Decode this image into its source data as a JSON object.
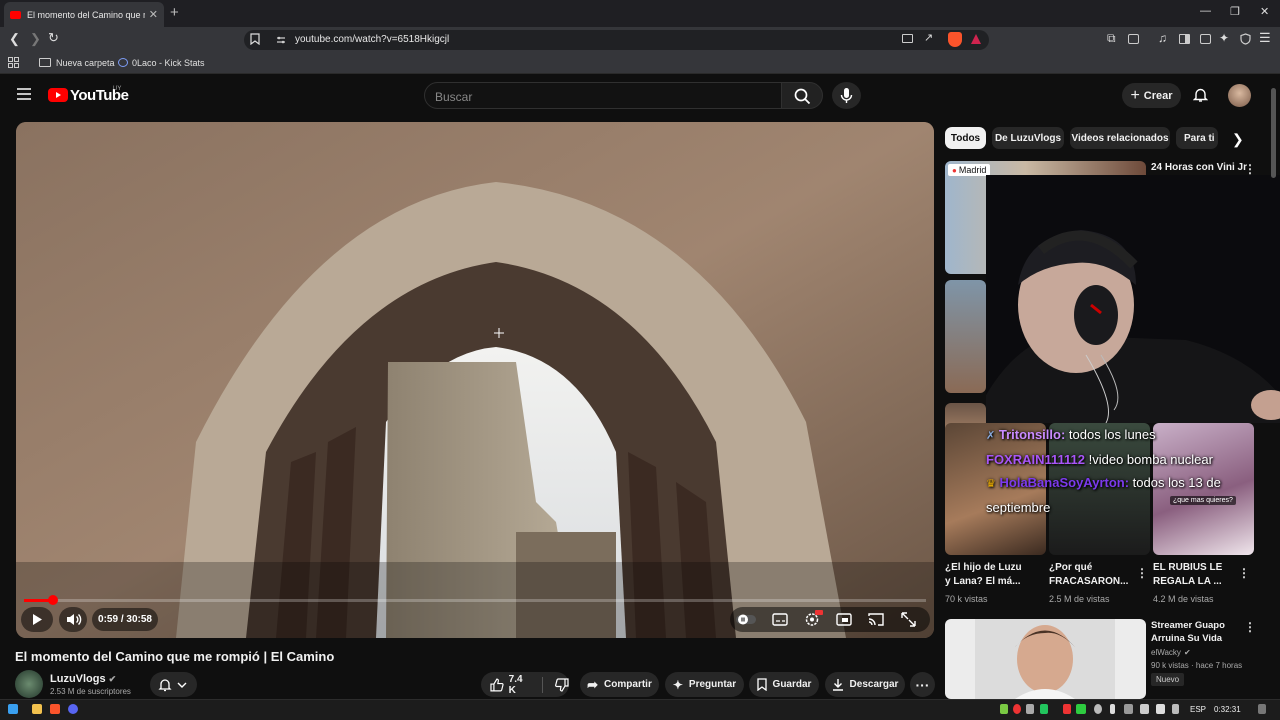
{
  "browser": {
    "tab_title": "El momento del Camino que me rompió | El Camino",
    "url": "youtube.com/watch?v=6518Hkigcjl",
    "bookmarks": [
      "Nueva carpeta",
      "0Laco - Kick Stats"
    ]
  },
  "youtube": {
    "logo_text": "YouTube",
    "country_code": "UY",
    "search_placeholder": "Buscar",
    "create_label": "Crear"
  },
  "player": {
    "time_display": "0:59 / 30:58",
    "progress": 0.032
  },
  "video": {
    "title": "El momento del Camino que me rompió | El Camino",
    "channel": "LuzuVlogs",
    "subscribers": "2.53 M de suscriptores",
    "likes": "7.4 K",
    "share_label": "Compartir",
    "ask_label": "Preguntar",
    "save_label": "Guardar",
    "download_label": "Descargar"
  },
  "chips": [
    "Todos",
    "De LuzuVlogs",
    "Videos relacionados",
    "Para ti"
  ],
  "related": {
    "top_title": "24 Horas con Vini Jr",
    "top_badge": "Madrid",
    "shorts": [
      {
        "title1": "¿El hijo de Luzu",
        "title2": "y Lana? El má...",
        "views": "70 k vistas"
      },
      {
        "title1": "¿Por qué",
        "title2": "FRACASARON...",
        "views": "2.5 M de vistas"
      },
      {
        "title1": "EL RUBIUS LE",
        "title2": "REGALA LA ...",
        "views": "4.2 M de vistas"
      }
    ],
    "bottom": {
      "title1": "Streamer Guapo",
      "title2": "Arruina Su Vida",
      "channel": "elWacky",
      "meta": "90 k vistas · hace 7 horas",
      "badge": "Nuevo"
    }
  },
  "stream_chat": [
    {
      "user": "Tritonsillo:",
      "msg": " todos los lunes",
      "color": "#c98bff"
    },
    {
      "user": "FOXRAIN111112",
      "msg": " !video bomba nuclear",
      "color": "#a855f7"
    },
    {
      "user": "HolaBanaSoyAyrton:",
      "msg": " todos los 13 de septiembre",
      "color": "#7c3aed"
    }
  ],
  "short_caption": "¿que mas quieres?",
  "taskbar": {
    "lang": "ESP",
    "time": "0:32:31"
  }
}
